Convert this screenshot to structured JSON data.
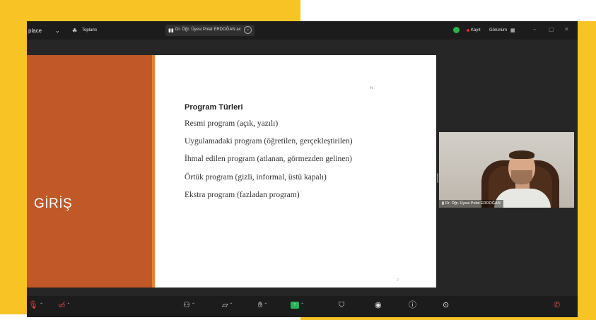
{
  "titlebar": {
    "workspace": "place",
    "meeting_label": "Toplantı",
    "share_text": "Dr. Öğr. Üyesi Polat ERDOĞAN ac",
    "record_label": "Kayıt",
    "view_label": "Görünüm"
  },
  "slide": {
    "section_title": "GİRİŞ",
    "heading": "Program Türleri",
    "lines": [
      "Resmi program (açık, yazılı)",
      "Uygulamadaki program (öğretilen, gerçekleştirilen)",
      "İhmal edilen program (atlanan, görmezden gelinen)",
      "Örtük program (gizli, informal, üstü kapalı)",
      "Ekstra program (fazladan program)"
    ],
    "page_mark": "2"
  },
  "video": {
    "participant_name": "Dr. Öğr. Üyesi Polat ERDOĞAN"
  },
  "colors": {
    "frame_accent": "#f8c324",
    "slide_accent": "#c05828",
    "secure_green": "#2ab34a",
    "share_green": "#27b35a"
  },
  "icons": [
    "chevron-down-icon",
    "people-icon",
    "shield-icon",
    "record-dot-icon",
    "minimize-icon",
    "maximize-icon",
    "microphone-icon",
    "camera-icon",
    "participants-icon",
    "chat-icon",
    "reactions-icon",
    "share-screen-icon",
    "security-icon",
    "record-icon",
    "info-icon",
    "more-icon",
    "leave-icon"
  ]
}
